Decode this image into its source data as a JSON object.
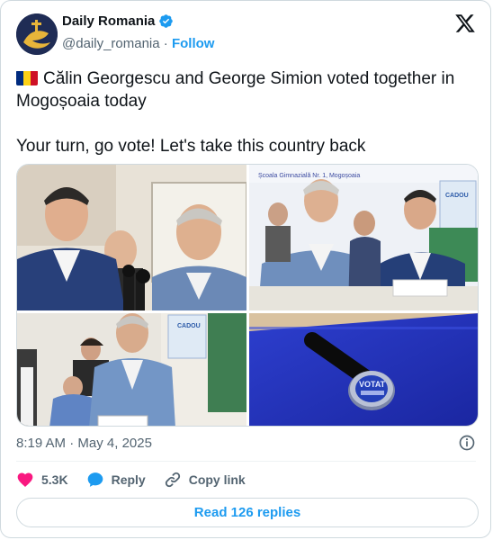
{
  "author": {
    "display_name": "Daily Romania",
    "handle": "@daily_romania",
    "separator": "·",
    "follow_label": "Follow",
    "verified": true
  },
  "tweet": {
    "flag": "romania-flag",
    "line1": "Călin Georgescu and George Simion voted together in Mogoșoaia today",
    "line2": "Your turn, go vote! Let's take this country back",
    "media_overlay_text": {
      "school_sign": "Școala Gimnazială Nr. 1, Mogoșoaia",
      "poster_top": "CADOU",
      "stamp": "VOTAT"
    }
  },
  "meta": {
    "time": "8:19 AM",
    "separator": "·",
    "date": "May 4, 2025"
  },
  "actions": {
    "likes": "5.3K",
    "reply_label": "Reply",
    "copy_link_label": "Copy link"
  },
  "read_replies_label": "Read 126 replies",
  "colors": {
    "accent": "#1d9bf0",
    "like": "#f91880",
    "text_secondary": "#536471",
    "border": "#cfd9de"
  },
  "icons": [
    "x-logo-icon",
    "verified-badge-icon",
    "info-icon",
    "heart-icon",
    "reply-bubble-icon",
    "link-icon"
  ]
}
